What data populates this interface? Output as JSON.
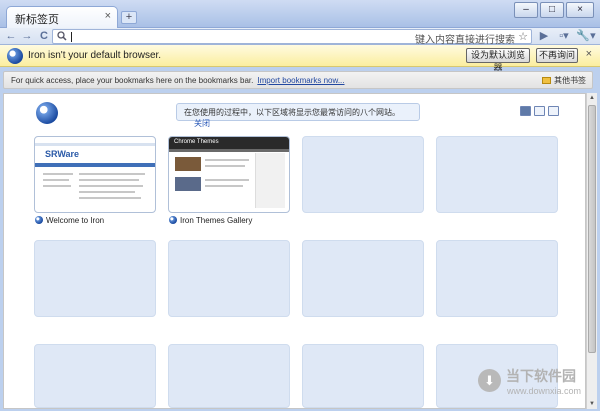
{
  "window": {
    "tab_title": "新标签页",
    "tab_close": "×",
    "new_tab": "+",
    "minimize": "–",
    "maximize": "□",
    "close": "×"
  },
  "toolbar": {
    "back_icon": "←",
    "forward_icon": "→",
    "reload_icon": "C",
    "omnibox_value": "",
    "omnibox_hint": "键入内容直接进行搜索",
    "star_icon": "☆",
    "go_icon": "▶",
    "page_menu_icon": "▫▾",
    "wrench_menu_icon": "🔧▾"
  },
  "infobar": {
    "message": "Iron isn't your default browser.",
    "set_default_label": "设为默认浏览器",
    "dont_ask_label": "不再询问",
    "close_icon": "×"
  },
  "bookmarks_bar": {
    "message": "For quick access, place your bookmarks here on the bookmarks bar.",
    "import_link": "Import bookmarks now...",
    "other_bookmarks": "其他书签"
  },
  "new_tab_page": {
    "hint_message": "在您使用的过程中，以下区域将显示您最常访问的八个网站。",
    "hint_close": "关闭",
    "tiles": [
      {
        "title": "Welcome to Iron",
        "thumbnail": "srware-page"
      },
      {
        "title": "Iron Themes Gallery",
        "thumbnail": "chrome-themes-page"
      },
      {
        "title": "",
        "thumbnail": "empty"
      },
      {
        "title": "",
        "thumbnail": "empty"
      },
      {
        "title": "",
        "thumbnail": "empty"
      },
      {
        "title": "",
        "thumbnail": "empty"
      },
      {
        "title": "",
        "thumbnail": "empty"
      },
      {
        "title": "",
        "thumbnail": "empty"
      },
      {
        "title": "",
        "thumbnail": "empty"
      },
      {
        "title": "",
        "thumbnail": "empty"
      },
      {
        "title": "",
        "thumbnail": "empty"
      },
      {
        "title": "",
        "thumbnail": "empty"
      }
    ],
    "mini_pages": {
      "srware_logo": "SRWare",
      "themes_header": "Chrome Themes"
    }
  },
  "watermark": {
    "title": "当下软件园",
    "subtitle": "www.downxia.com",
    "arrow_icon": "⬇"
  },
  "colors": {
    "frame": "#bcd0ee",
    "infobar": "#fbee9f",
    "tile_empty": "#dfe8f6",
    "link": "#2248a0"
  }
}
